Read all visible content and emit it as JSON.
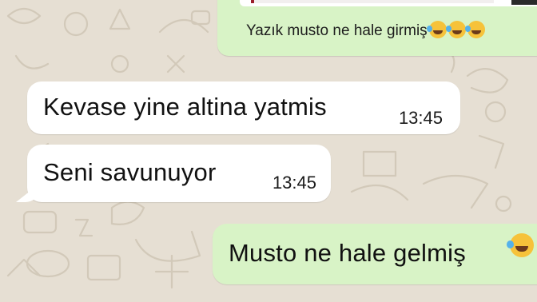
{
  "chat": {
    "messages": [
      {
        "id": "prev",
        "direction": "outgoing",
        "text": "Yazık musto ne hale girmiş",
        "emojis": [
          "face-with-tears-of-joy-icon",
          "rolling-on-floor-laughing-icon",
          "face-with-tears-of-joy-icon"
        ]
      },
      {
        "id": "m1",
        "direction": "incoming",
        "text": "Kevase yine altina yatmis",
        "time": "13:45"
      },
      {
        "id": "m2",
        "direction": "incoming",
        "text": "Seni savunuyor",
        "time": "13:45"
      },
      {
        "id": "m3",
        "direction": "outgoing",
        "text": "Musto ne hale gelmiş",
        "emojis": [
          "face-with-tears-of-joy-icon"
        ]
      }
    ]
  },
  "colors": {
    "background": "#e6dfd3",
    "incoming_bubble": "#ffffff",
    "outgoing_bubble": "#d8f3c6",
    "doodle_stroke": "#d2c9b9"
  }
}
